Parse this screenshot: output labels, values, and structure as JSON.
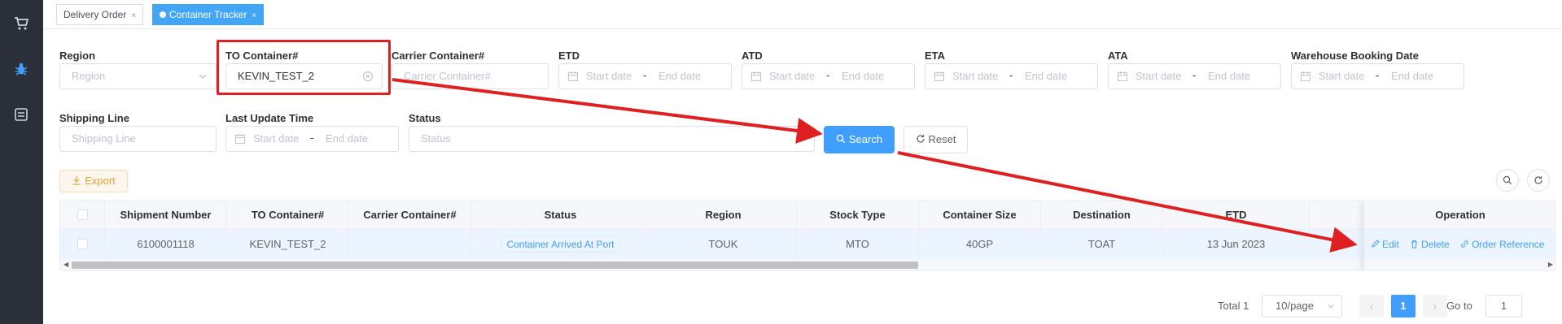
{
  "tabs": [
    {
      "label": "Delivery Order",
      "close": "×"
    },
    {
      "label": "Container Tracker",
      "close": "×"
    }
  ],
  "filters": {
    "region": {
      "label": "Region",
      "placeholder": "Region"
    },
    "to_container": {
      "label": "TO Container#",
      "value": "KEVIN_TEST_2"
    },
    "carrier_container": {
      "label": "Carrier Container#",
      "placeholder": "Carrier Container#"
    },
    "etd": {
      "label": "ETD"
    },
    "atd": {
      "label": "ATD"
    },
    "eta": {
      "label": "ETA"
    },
    "ata": {
      "label": "ATA"
    },
    "warehouse_booking_date": {
      "label": "Warehouse Booking Date"
    },
    "shipping_line": {
      "label": "Shipping Line",
      "placeholder": "Shipping Line"
    },
    "last_update_time": {
      "label": "Last Update Time"
    },
    "status": {
      "label": "Status",
      "placeholder": "Status"
    },
    "date_start": "Start date",
    "date_end": "End date",
    "date_sep": "-"
  },
  "actions": {
    "search": "Search",
    "reset": "Reset",
    "export": "Export"
  },
  "table": {
    "columns": [
      "Shipment Number",
      "TO Container#",
      "Carrier Container#",
      "Status",
      "Region",
      "Stock Type",
      "Container Size",
      "Destination",
      "ETD",
      "Operation"
    ],
    "rows": [
      {
        "shipment_number": "6100001118",
        "to_container": "KEVIN_TEST_2",
        "carrier_container": "",
        "status": "Container Arrived At Port",
        "region": "TOUK",
        "stock_type": "MTO",
        "container_size": "40GP",
        "destination": "TOAT",
        "etd": "13 Jun 2023"
      }
    ],
    "operations": {
      "edit": "Edit",
      "delete": "Delete",
      "order_reference": "Order Reference"
    }
  },
  "pagination": {
    "total": "Total 1",
    "page_size": "10/page",
    "current_page": "1",
    "goto_label": "Go to",
    "goto_value": "1"
  },
  "colors": {
    "primary": "#409eff",
    "annotation": "#e02020",
    "sidebar": "#2b2f3a",
    "export": "#e6a23c"
  }
}
